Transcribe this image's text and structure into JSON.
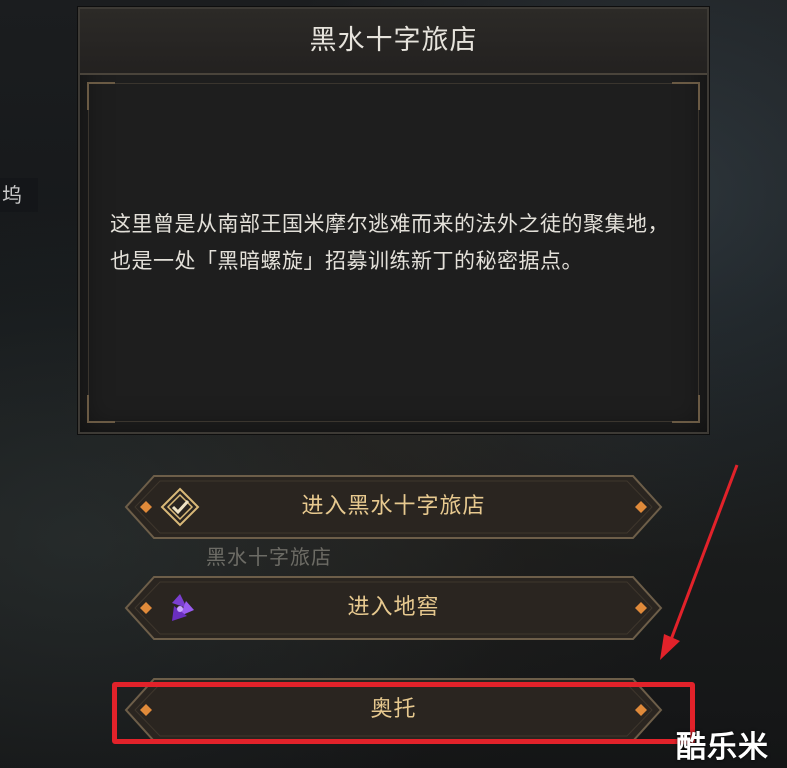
{
  "background": {
    "side_label": "坞",
    "sub_label": "黑水十字旅店"
  },
  "panel": {
    "title": "黑水十字旅店",
    "description": "这里曾是从南部王国米摩尔逃难而来的法外之徒的聚集地，也是一处「黑暗螺旋」招募训练新丁的秘密据点。"
  },
  "buttons": [
    {
      "label": "进入黑水十字旅店",
      "icon": "inn-check-icon"
    },
    {
      "label": "进入地窖",
      "icon": "purple-spiral-icon"
    },
    {
      "label": "奥托",
      "icon": ""
    }
  ],
  "annotation": {
    "highlight_color": "#e2222a",
    "arrow_color": "#e2222a"
  },
  "watermark": "酷乐米",
  "colors": {
    "button_text": "#e7c98f",
    "panel_bg": "#1e1e1e",
    "accent_orange": "#e08a3a"
  }
}
